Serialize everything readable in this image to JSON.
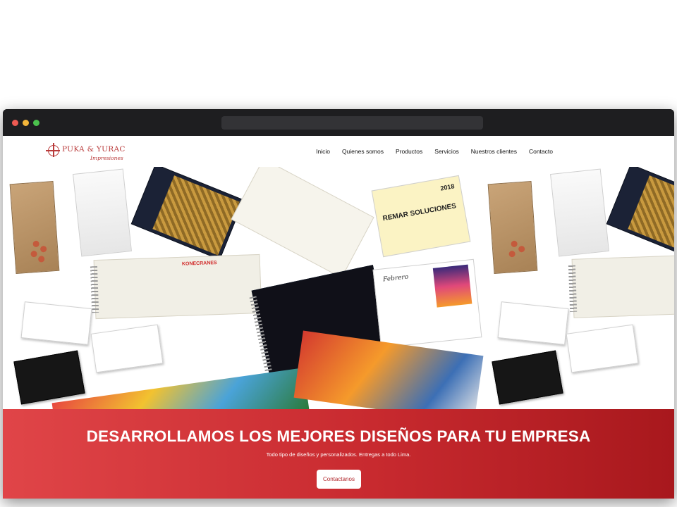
{
  "browser": {
    "url": ""
  },
  "logo": {
    "name": "PUKA & YURAC",
    "tagline": "Impresiones"
  },
  "nav": {
    "items": [
      "Inicio",
      "Quienes somos",
      "Productos",
      "Servicios",
      "Nuestros clientes",
      "Contacto"
    ]
  },
  "collage": {
    "brand_kone": "KONECRANES",
    "brand_remar": "REMAR SOLUCIONES",
    "calendar_year": "2018",
    "calendar_month": "Febrero"
  },
  "hero": {
    "title": "DESARROLLAMOS LOS MEJORES DISEÑOS PARA TU EMPRESA",
    "subtitle": "Todo tipo de diseños y personalizados. Entregas a todo Lima.",
    "cta": "Contactanos"
  },
  "colors": {
    "accent": "#c82a2f",
    "logo": "#b93a3a",
    "chrome": "#1e1e20"
  }
}
